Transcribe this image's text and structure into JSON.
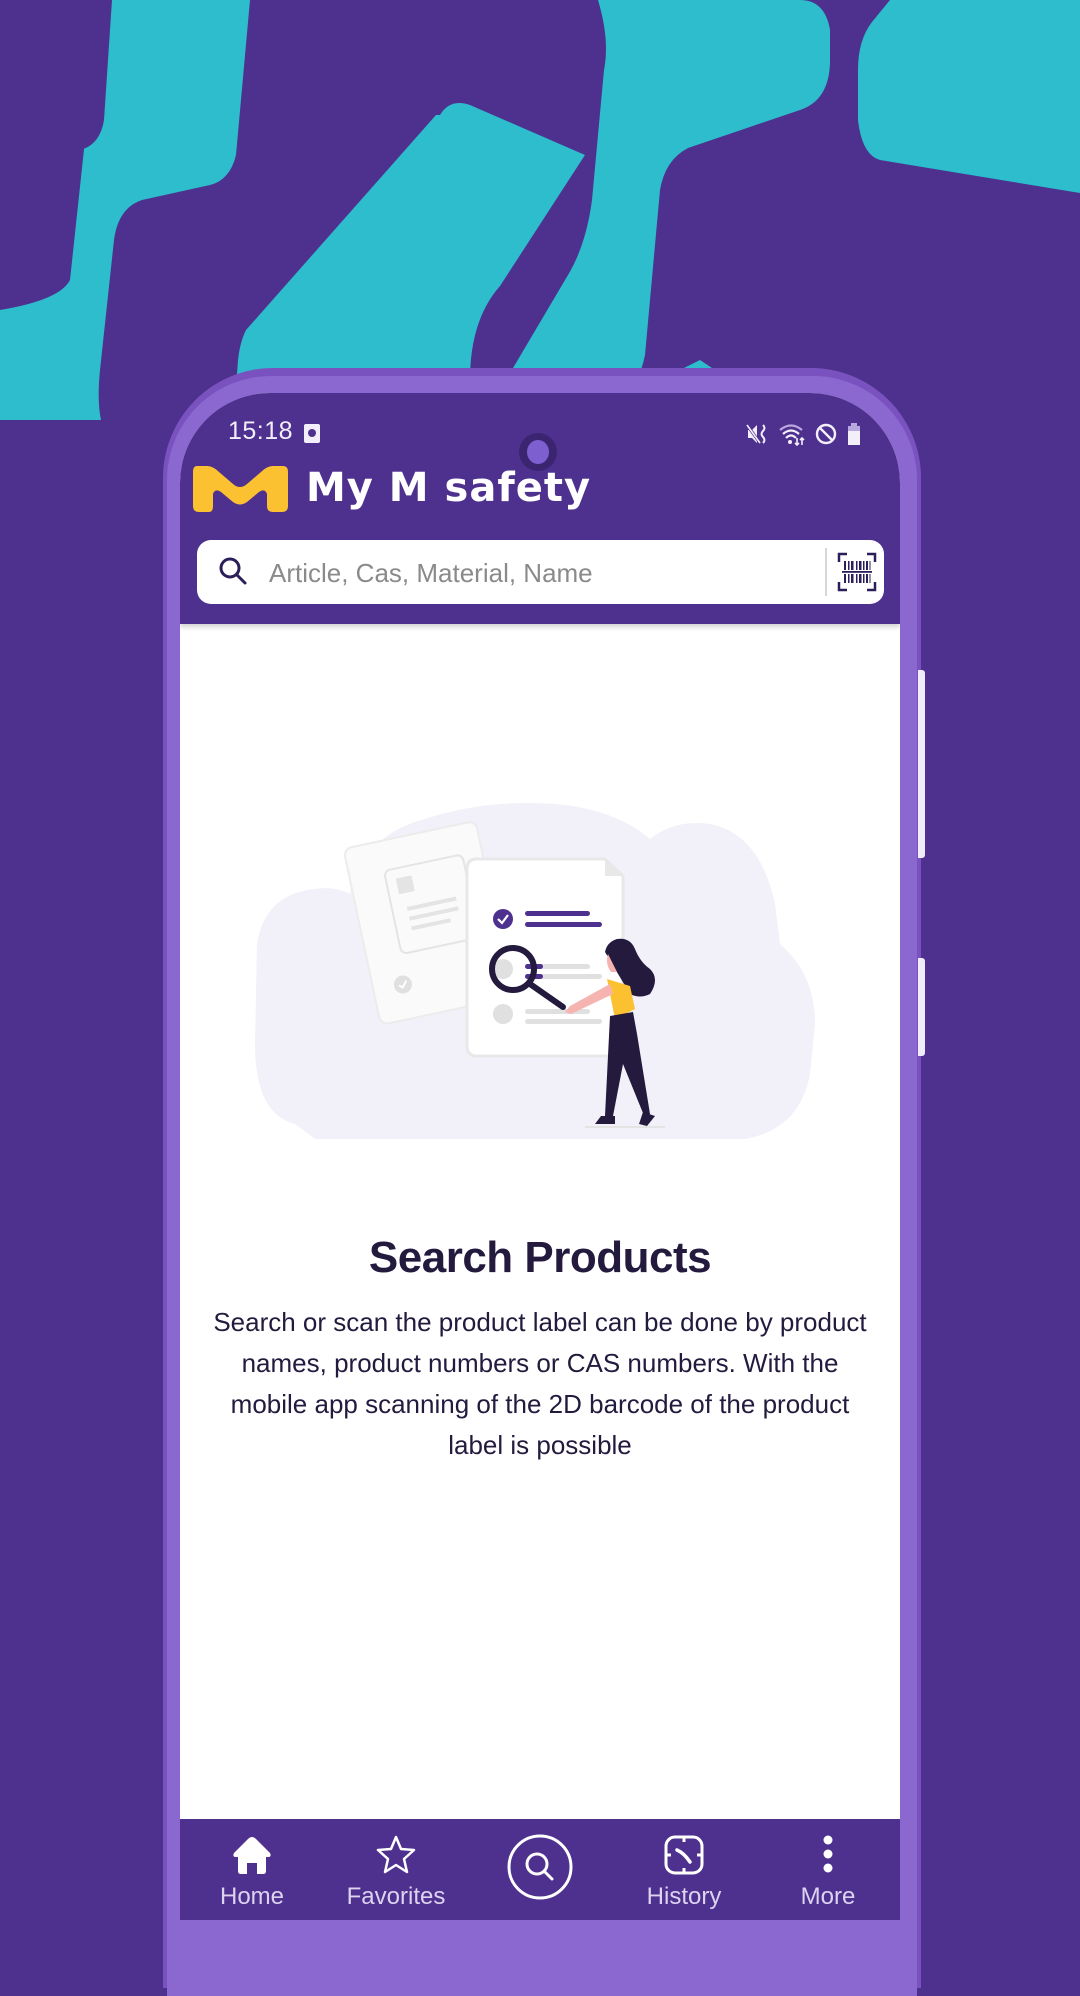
{
  "status_bar": {
    "time": "15:18",
    "icons": [
      "screen-time-icon",
      "mute-vibrate-icon",
      "wifi-icon",
      "do-not-disturb-icon",
      "battery-icon"
    ]
  },
  "header": {
    "logo_text": "My M safety",
    "logo_icon": "m-logo-icon"
  },
  "search": {
    "value": "",
    "placeholder": "Article, Cas, Material, Name",
    "scan_icon": "barcode-scan-icon"
  },
  "main": {
    "illustration": "woman-with-magnifier-searching-documents",
    "title": "Search Products",
    "description": "Search or scan the product label can be done by product names, product numbers or CAS numbers. With the mobile app scanning of the 2D barcode of the product label is possible"
  },
  "bottom_nav": {
    "items": [
      {
        "label": "Home",
        "icon": "home-icon",
        "active": true
      },
      {
        "label": "Favorites",
        "icon": "star-icon",
        "active": false
      },
      {
        "label": "",
        "icon": "search-circle-icon",
        "active": false
      },
      {
        "label": "History",
        "icon": "history-icon",
        "active": false
      },
      {
        "label": "More",
        "icon": "more-vertical-icon",
        "active": false
      }
    ]
  },
  "colors": {
    "brand_purple": "#4e318e",
    "accent_yellow": "#fcc130",
    "teal_background": "#2dbdcc",
    "frame_purple": "#8a68d0",
    "text_dark": "#231a3e"
  }
}
